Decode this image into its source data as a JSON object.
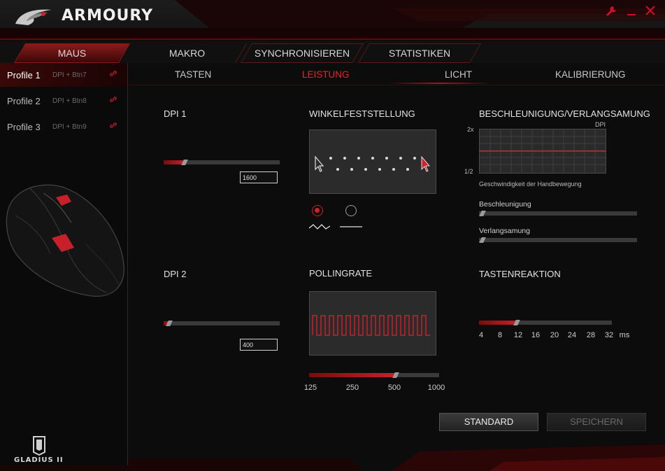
{
  "app": {
    "title": "ARMOURY",
    "accent": "#d0202a"
  },
  "window_controls": [
    {
      "icon": "wrench-icon",
      "glyph": "🔧"
    },
    {
      "icon": "minimize-icon",
      "glyph": "—"
    },
    {
      "icon": "close-icon",
      "glyph": "✕"
    }
  ],
  "main_tabs": [
    {
      "label": "MAUS",
      "active": true
    },
    {
      "label": "MAKRO",
      "active": false
    },
    {
      "label": "SYNCHRONISIEREN",
      "active": false
    },
    {
      "label": "STATISTIKEN",
      "active": false
    }
  ],
  "profiles": [
    {
      "name": "Profile 1",
      "binding": "DPI + Btn7",
      "active": true
    },
    {
      "name": "Profile 2",
      "binding": "DPI + Btn8",
      "active": false
    },
    {
      "name": "Profile 3",
      "binding": "DPI + Btn9",
      "active": false
    }
  ],
  "device": {
    "name": "GLADIUS II"
  },
  "sub_tabs": [
    {
      "label": "TASTEN",
      "active": false
    },
    {
      "label": "LEISTUNG",
      "active": true
    },
    {
      "label": "LICHT",
      "active": false
    },
    {
      "label": "KALIBRIERUNG",
      "active": false
    }
  ],
  "dpi1": {
    "title": "DPI 1",
    "value": "1600",
    "fraction": 0.18
  },
  "dpi2": {
    "title": "DPI 2",
    "value": "400",
    "fraction": 0.05
  },
  "angle_snapping": {
    "title": "WINKELFESTSTELLUNG",
    "selected": "zigzag"
  },
  "polling": {
    "title": "POLLINGRATE",
    "ticks": [
      "125",
      "250",
      "500",
      "1000"
    ],
    "selected_index": 2
  },
  "acceleration": {
    "title": "BESCHLEUNIGUNG/VERLANGSAMUNG",
    "dpi_label": "DPI",
    "y_top": "2x",
    "y_bottom": "1/2",
    "x_label": "Geschwindigkeit der Handbewegung",
    "accel_label": "Beschleunigung",
    "accel_value": 0.0,
    "decel_label": "Verlangsamung",
    "decel_value": 0.0
  },
  "response": {
    "title": "TASTENREAKTION",
    "ticks": [
      "4",
      "8",
      "12",
      "16",
      "20",
      "24",
      "28",
      "32"
    ],
    "unit": "ms",
    "selected_index": 2
  },
  "buttons": {
    "standard": "STANDARD",
    "save": "SPEICHERN"
  }
}
